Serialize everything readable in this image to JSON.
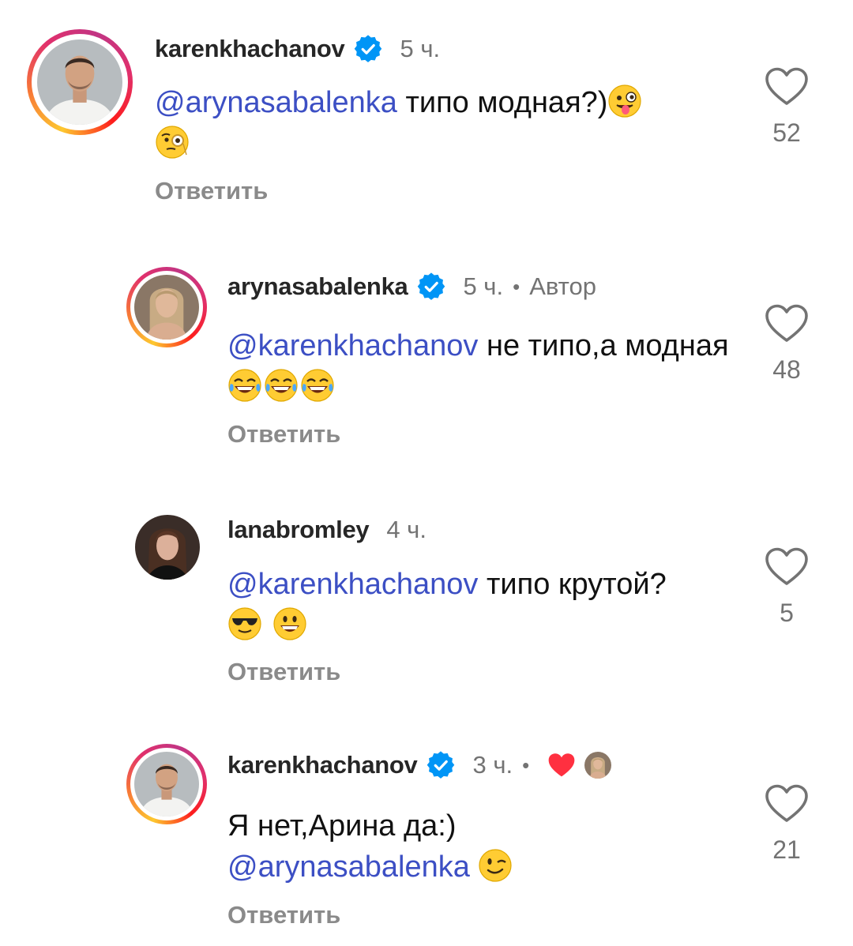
{
  "comments": [
    {
      "username": "karenkhachanov",
      "verified": true,
      "time": "5 ч.",
      "mention": "@arynasabalenka",
      "text": " типо модная?)",
      "emojis": [
        "winking-tongue-emoji",
        "monocle-face-emoji"
      ],
      "reply_label": "Ответить",
      "likes": "52"
    },
    {
      "username": "arynasabalenka",
      "verified": true,
      "time": "5 ч.",
      "separator": "•",
      "author_label": "Автор",
      "mention": "@karenkhachanov",
      "text": " не типо,а модная ",
      "emojis": [
        "tears-of-joy-emoji",
        "tears-of-joy-emoji",
        "tears-of-joy-emoji"
      ],
      "reply_label": "Ответить",
      "likes": "48"
    },
    {
      "username": "lanabromley",
      "verified": false,
      "time": "4 ч.",
      "mention": "@karenkhachanov",
      "text": " типо крутой?",
      "emojis": [
        "sunglasses-emoji",
        "grinning-emoji"
      ],
      "reply_label": "Ответить",
      "likes": "5"
    },
    {
      "username": "karenkhachanov",
      "verified": true,
      "time": "3 ч.",
      "separator": "•",
      "liked_by_author": true,
      "pre_text": "Я нет,Арина да:)",
      "mention": "@arynasabalenka",
      "emojis": [
        "wink-emoji"
      ],
      "reply_label": "Ответить",
      "likes": "21"
    }
  ],
  "colors": {
    "mention": "#3c4fc4",
    "verified_badge": "#0095f6",
    "liked_heart": "#ff3040",
    "muted_text": "#737373"
  }
}
